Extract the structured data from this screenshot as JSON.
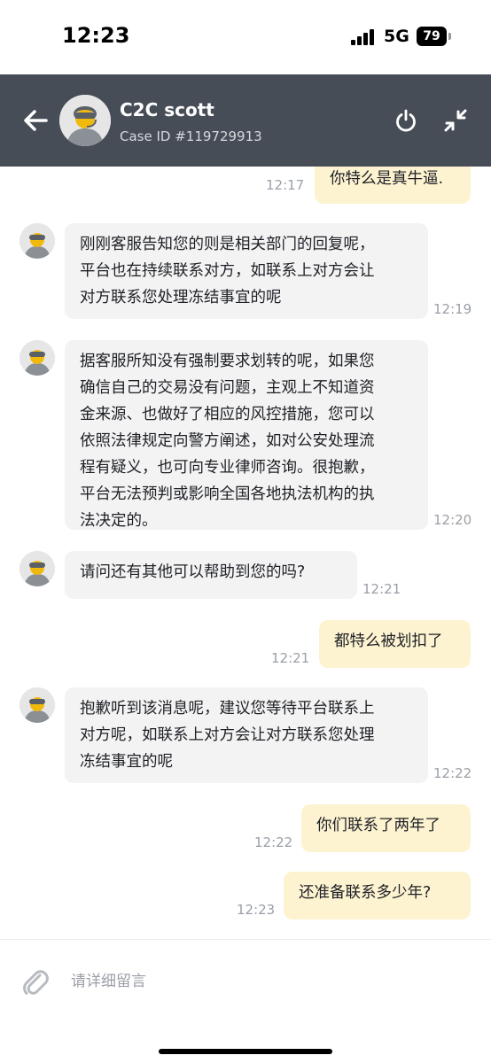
{
  "status_bar": {
    "time": "12:23",
    "network": "5G",
    "battery": "79"
  },
  "header": {
    "agent_name": "C2C scott",
    "case_id": "Case ID #119729913",
    "icons": {
      "back": "arrow-left-icon",
      "power": "power-icon",
      "minimize": "minimize-arrows-icon"
    }
  },
  "messages": [
    {
      "side": "out",
      "text": "你特么是真牛逼.",
      "time": "12:17"
    },
    {
      "side": "in",
      "text": "刚刚客服告知您的则是相关部门的回复呢，\n平台也在持续联系对方，如联系上对方会让\n对方联系您处理冻结事宜的呢",
      "time": "12:19"
    },
    {
      "side": "in",
      "text": "据客服所知没有强制要求划转的呢，如果您\n确信自己的交易没有问题，主观上不知道资\n金来源、也做好了相应的风控措施，您可以\n依照法律规定向警方阐述，如对公安处理流\n程有疑义，也可向专业律师咨询。很抱歉，\n平台无法预判或影响全国各地执法机构的执\n法决定的。",
      "time": "12:20"
    },
    {
      "side": "in",
      "text": "请问还有其他可以帮助到您的吗?",
      "time": "12:21"
    },
    {
      "side": "out",
      "text": "都特么被划扣了",
      "time": "12:21"
    },
    {
      "side": "in",
      "text": "抱歉听到该消息呢，建议您等待平台联系上\n对方呢，如联系上对方会让对方联系您处理\n冻结事宜的呢",
      "time": "12:22"
    },
    {
      "side": "out",
      "text": "你们联系了两年了",
      "time": "12:22"
    },
    {
      "side": "out",
      "text": "还准备联系多少年?",
      "time": "12:23"
    }
  ],
  "composer": {
    "placeholder": "请详细留言",
    "value": "",
    "attach_icon": "paperclip-icon"
  },
  "colors": {
    "header_bg": "#474d57",
    "incoming_bubble": "#f3f3f3",
    "outgoing_bubble": "#fdf3d0",
    "timestamp": "#9a9fa6"
  }
}
